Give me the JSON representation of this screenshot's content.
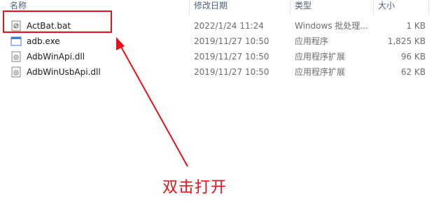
{
  "columns": {
    "name": "名称",
    "modified": "修改日期",
    "type": "类型",
    "size": "大小"
  },
  "files": [
    {
      "name": "ActBat.bat",
      "modified": "2022/1/24 11:24",
      "type": "Windows 批处理...",
      "size": "1 KB",
      "icon": "batch-file-icon"
    },
    {
      "name": "adb.exe",
      "modified": "2019/11/27 10:50",
      "type": "应用程序",
      "size": "1,825 KB",
      "icon": "exe-file-icon"
    },
    {
      "name": "AdbWinApi.dll",
      "modified": "2019/11/27 10:50",
      "type": "应用程序扩展",
      "size": "96 KB",
      "icon": "dll-file-icon"
    },
    {
      "name": "AdbWinUsbApi.dll",
      "modified": "2019/11/27 10:50",
      "type": "应用程序扩展",
      "size": "62 KB",
      "icon": "dll-file-icon"
    }
  ],
  "annotation": {
    "text": "双击打开",
    "color": "#e8101a"
  }
}
